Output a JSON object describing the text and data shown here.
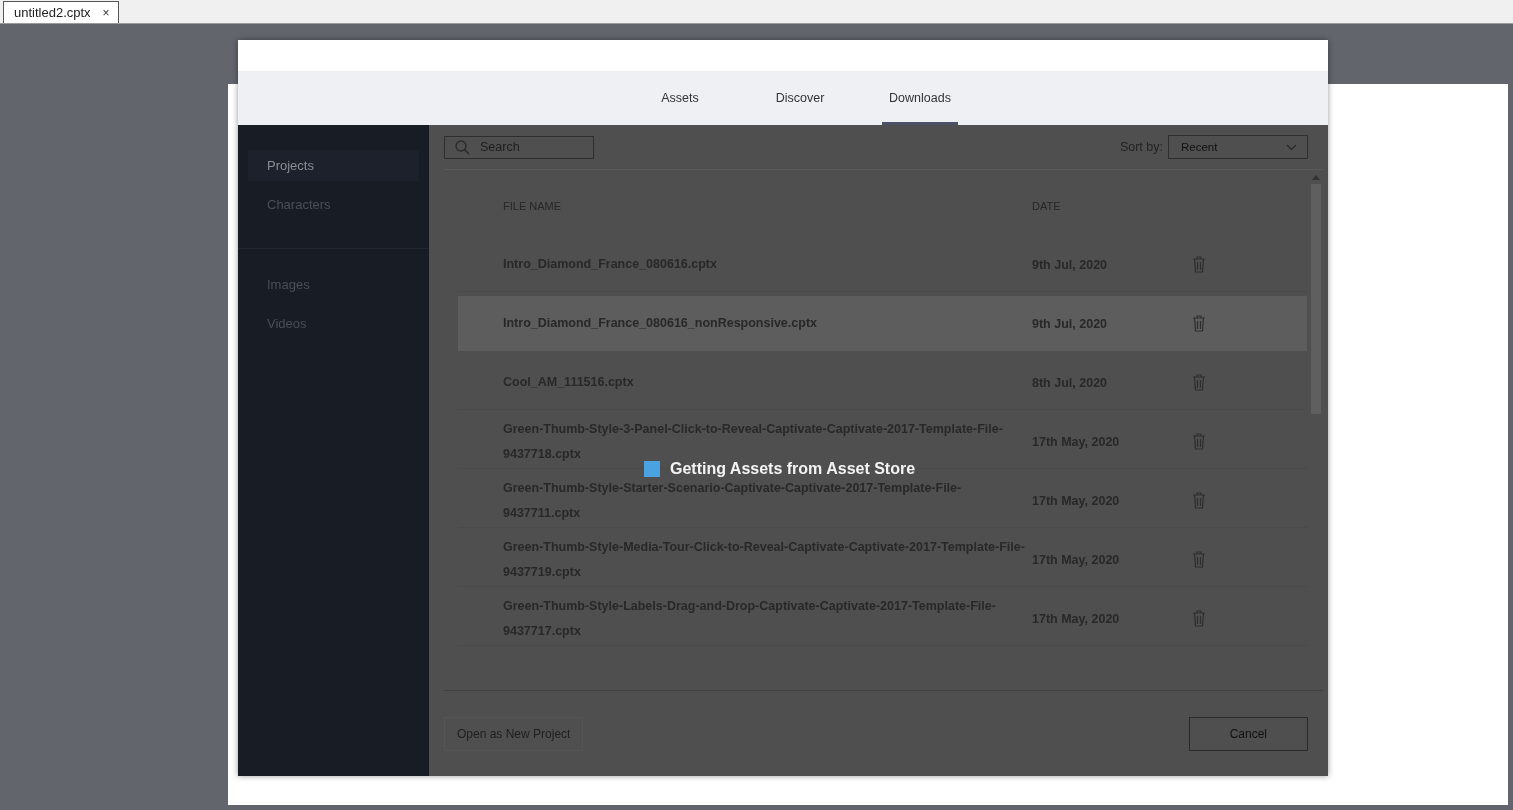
{
  "document_tabs": [
    {
      "label": "untitled2.cptx",
      "close": "×",
      "selected": true
    }
  ],
  "dialog": {
    "tabs": [
      {
        "label": "Assets",
        "selected": false
      },
      {
        "label": "Discover",
        "selected": false
      },
      {
        "label": "Downloads",
        "selected": true
      }
    ],
    "sidebar": {
      "groups": [
        [
          {
            "label": "Projects",
            "selected": true
          },
          {
            "label": "Characters",
            "selected": false
          }
        ],
        [
          {
            "label": "Images",
            "selected": false
          },
          {
            "label": "Videos",
            "selected": false
          }
        ]
      ]
    },
    "search": {
      "placeholder": "Search"
    },
    "sort": {
      "label": "Sort by:",
      "value": "Recent"
    },
    "table": {
      "columns": [
        "FILE NAME",
        "DATE"
      ],
      "rows": [
        {
          "name": "Intro_Diamond_France_080616.cptx",
          "date": "9th Jul, 2020",
          "selected": false
        },
        {
          "name": "Intro_Diamond_France_080616_nonResponsive.cptx",
          "date": "9th Jul, 2020",
          "selected": true
        },
        {
          "name": "Cool_AM_111516.cptx",
          "date": "8th Jul, 2020",
          "selected": false
        },
        {
          "name": "Green-Thumb-Style-3-Panel-Click-to-Reveal-Captivate-Captivate-2017-Template-File-9437718.cptx",
          "date": "17th May, 2020",
          "selected": false
        },
        {
          "name": "Green-Thumb-Style-Starter-Scenario-Captivate-Captivate-2017-Template-File-9437711.cptx",
          "date": "17th May, 2020",
          "selected": false
        },
        {
          "name": "Green-Thumb-Style-Media-Tour-Click-to-Reveal-Captivate-Captivate-2017-Template-File-9437719.cptx",
          "date": "17th May, 2020",
          "selected": false
        },
        {
          "name": "Green-Thumb-Style-Labels-Drag-and-Drop-Captivate-Captivate-2017-Template-File-9437717.cptx",
          "date": "17th May, 2020",
          "selected": false
        }
      ]
    },
    "buttons": [
      {
        "label": "Open as New Project",
        "disabled": true
      },
      {
        "label": "Cancel",
        "disabled": false
      }
    ],
    "loading": {
      "message": "Getting Assets from Asset Store"
    }
  }
}
